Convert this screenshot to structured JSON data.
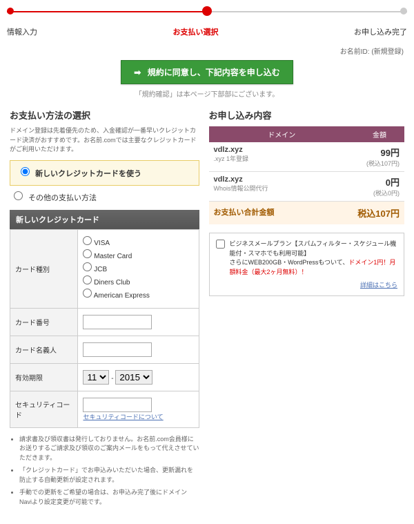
{
  "progress": {
    "step1": "情報入力",
    "step2": "お支払い選択",
    "step3": "お申し込み完了"
  },
  "topright": "お名前ID: (新規登録)",
  "submit_button": "規約に同意し、下記内容を申し込む",
  "submit_note": "「規約確認」は本ページ下部部にございます。",
  "left": {
    "title": "お支払い方法の選択",
    "desc": "ドメイン登録は先着優先のため、入金確認が一番早いクレジットカード決済がおすすめです。お名前.comでは主要なクレジットカードがご利用いただけます。",
    "radio_new": "新しいクレジットカードを使う",
    "radio_other": "その他の支払い方法",
    "subhead": "新しいクレジットカード",
    "form": {
      "card_type_label": "カード種別",
      "card_types": [
        "VISA",
        "Master Card",
        "JCB",
        "Diners Club",
        "American Express"
      ],
      "card_number_label": "カード番号",
      "card_name_label": "カード名義人",
      "expiry_label": "有効期限",
      "expiry_month": "11",
      "expiry_year": "2015",
      "cvv_label": "セキュリティコード",
      "cvv_link": "セキュリティコードについて"
    },
    "notes": [
      "請求書及び領収書は発行しておりません。お名前.com会員様にお送りするご請求及び領収のご案内メールをもって代えさせていただきます。",
      "「クレジットカード」でお申込みいただいた場合、更新漏れを防止する自動更新が設定されます。",
      "手動での更新をご希望の場合は、お申込み完了後にドメインNaviより設定変更が可能です。"
    ]
  },
  "right": {
    "title": "お申し込み内容",
    "head_domain": "ドメイン",
    "head_price": "金額",
    "items": [
      {
        "name": "vdlz.xyz",
        "sub": ".xyz 1年登録",
        "price": "99円",
        "price_sub": "(税込107円)"
      },
      {
        "name": "vdlz.xyz",
        "sub": "Whois情報公開代行",
        "price": "0円",
        "price_sub": "(税込0円)"
      }
    ],
    "total_label": "お支払い合計金額",
    "total_value": "税込107円",
    "promo_main": "ビジネスメールプラン【スパムフィルター・スケジュール機能付・スマホでも利用可能】",
    "promo_sub1": "さらにWEB200GB・WordPressもついて、",
    "promo_hl": "ドメイン1円！月額料金（最大2ヶ月無料）！",
    "promo_link": "詳細はこちら"
  }
}
